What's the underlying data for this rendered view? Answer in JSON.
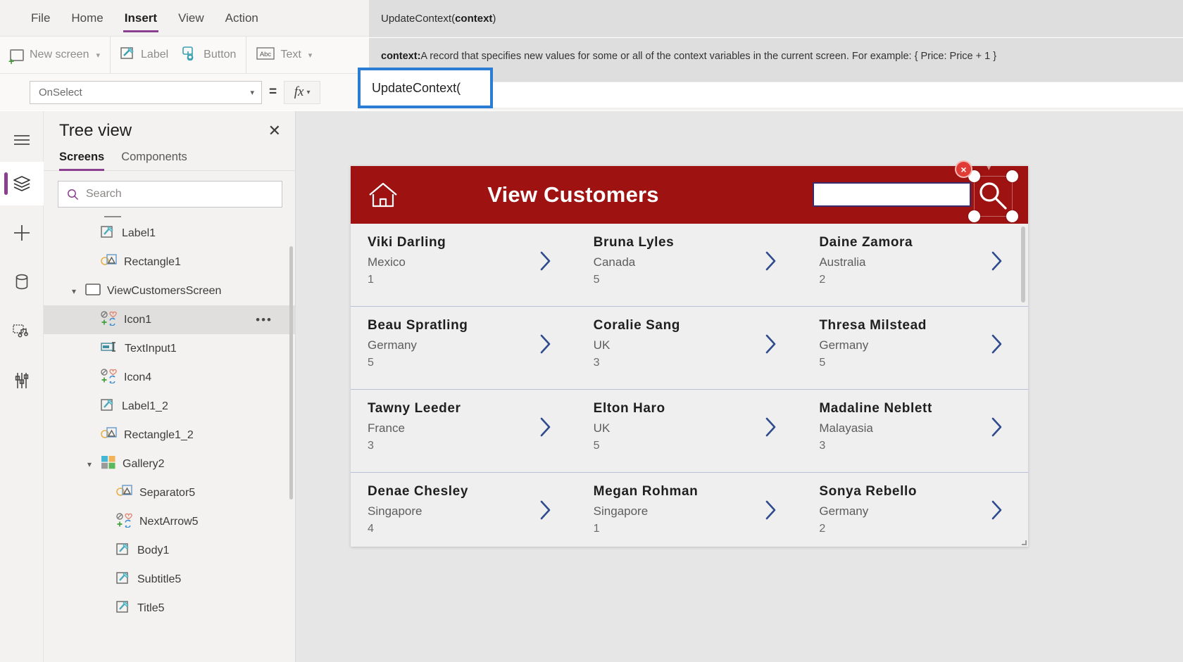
{
  "menubar": {
    "items": [
      {
        "label": "File",
        "active": false
      },
      {
        "label": "Home",
        "active": false
      },
      {
        "label": "Insert",
        "active": true
      },
      {
        "label": "View",
        "active": false
      },
      {
        "label": "Action",
        "active": false
      }
    ]
  },
  "ribbon": {
    "new_screen": "New screen",
    "label": "Label",
    "button": "Button",
    "text": "Text"
  },
  "formula": {
    "property": "OnSelect",
    "equals": "=",
    "value": "UpdateContext(",
    "intellisense_signature_prefix": "UpdateContext(",
    "intellisense_signature_arg": "context",
    "intellisense_signature_suffix": ")",
    "intellisense_param": "context:",
    "intellisense_desc": " A record that specifies new values for some or all of the context variables in the current screen. For example: { Price: Price + 1 }"
  },
  "treeview": {
    "title": "Tree view",
    "tabs": [
      {
        "label": "Screens",
        "active": true
      },
      {
        "label": "Components",
        "active": false
      }
    ],
    "search_placeholder": "Search",
    "search_value": "",
    "nodes": [
      {
        "label": "Label1",
        "icon": "label-icon",
        "indent": 2,
        "chevron": "",
        "selected": false,
        "dots": false
      },
      {
        "label": "Rectangle1",
        "icon": "shape-icon",
        "indent": 2,
        "chevron": "",
        "selected": false,
        "dots": false
      },
      {
        "label": "ViewCustomersScreen",
        "icon": "screen-icon",
        "indent": 1,
        "chevron": "v",
        "selected": false,
        "dots": false
      },
      {
        "label": "Icon1",
        "icon": "icon-glyph",
        "indent": 2,
        "chevron": "",
        "selected": true,
        "dots": true
      },
      {
        "label": "TextInput1",
        "icon": "textinput-icon",
        "indent": 2,
        "chevron": "",
        "selected": false,
        "dots": false
      },
      {
        "label": "Icon4",
        "icon": "icon-glyph",
        "indent": 2,
        "chevron": "",
        "selected": false,
        "dots": false
      },
      {
        "label": "Label1_2",
        "icon": "label-icon",
        "indent": 2,
        "chevron": "",
        "selected": false,
        "dots": false
      },
      {
        "label": "Rectangle1_2",
        "icon": "shape-icon",
        "indent": 2,
        "chevron": "",
        "selected": false,
        "dots": false
      },
      {
        "label": "Gallery2",
        "icon": "gallery-icon",
        "indent": 2,
        "chevron": "v",
        "selected": false,
        "dots": false
      },
      {
        "label": "Separator5",
        "icon": "shape-icon",
        "indent": 3,
        "chevron": "",
        "selected": false,
        "dots": false
      },
      {
        "label": "NextArrow5",
        "icon": "icon-glyph",
        "indent": 3,
        "chevron": "",
        "selected": false,
        "dots": false
      },
      {
        "label": "Body1",
        "icon": "label-icon",
        "indent": 3,
        "chevron": "",
        "selected": false,
        "dots": false
      },
      {
        "label": "Subtitle5",
        "icon": "label-icon",
        "indent": 3,
        "chevron": "",
        "selected": false,
        "dots": false
      },
      {
        "label": "Title5",
        "icon": "label-icon",
        "indent": 3,
        "chevron": "",
        "selected": false,
        "dots": false
      }
    ]
  },
  "rail": {
    "items": [
      "hamburger-icon",
      "layers-icon",
      "plus-icon",
      "database-icon",
      "media-icon",
      "tools-icon"
    ]
  },
  "app": {
    "header": {
      "title": "View Customers",
      "home_icon": "home-icon",
      "search_icon": "magnifier-icon",
      "search_value": "",
      "brand_color": "#9e1212"
    },
    "gallery": {
      "rows": [
        [
          {
            "title": "Viki  Darling",
            "subtitle": "Mexico",
            "body": "1"
          },
          {
            "title": "Bruna  Lyles",
            "subtitle": "Canada",
            "body": "5"
          },
          {
            "title": "Daine Zamora",
            "subtitle": "Australia",
            "body": "2"
          }
        ],
        [
          {
            "title": "Beau Spratling",
            "subtitle": "Germany",
            "body": "5"
          },
          {
            "title": "Coralie Sang",
            "subtitle": "UK",
            "body": "3"
          },
          {
            "title": "Thresa Milstead",
            "subtitle": "Germany",
            "body": "5"
          }
        ],
        [
          {
            "title": "Tawny Leeder",
            "subtitle": "France",
            "body": "3"
          },
          {
            "title": "Elton Haro",
            "subtitle": "UK",
            "body": "5"
          },
          {
            "title": "Madaline Neblett",
            "subtitle": "Malayasia",
            "body": "3"
          }
        ],
        [
          {
            "title": "Denae Chesley",
            "subtitle": "Singapore",
            "body": "4"
          },
          {
            "title": "Megan Rohman",
            "subtitle": "Singapore",
            "body": "1"
          },
          {
            "title": "Sonya Rebello",
            "subtitle": "Germany",
            "body": "2"
          }
        ]
      ]
    },
    "selection": {
      "delete_badge": "×"
    }
  }
}
